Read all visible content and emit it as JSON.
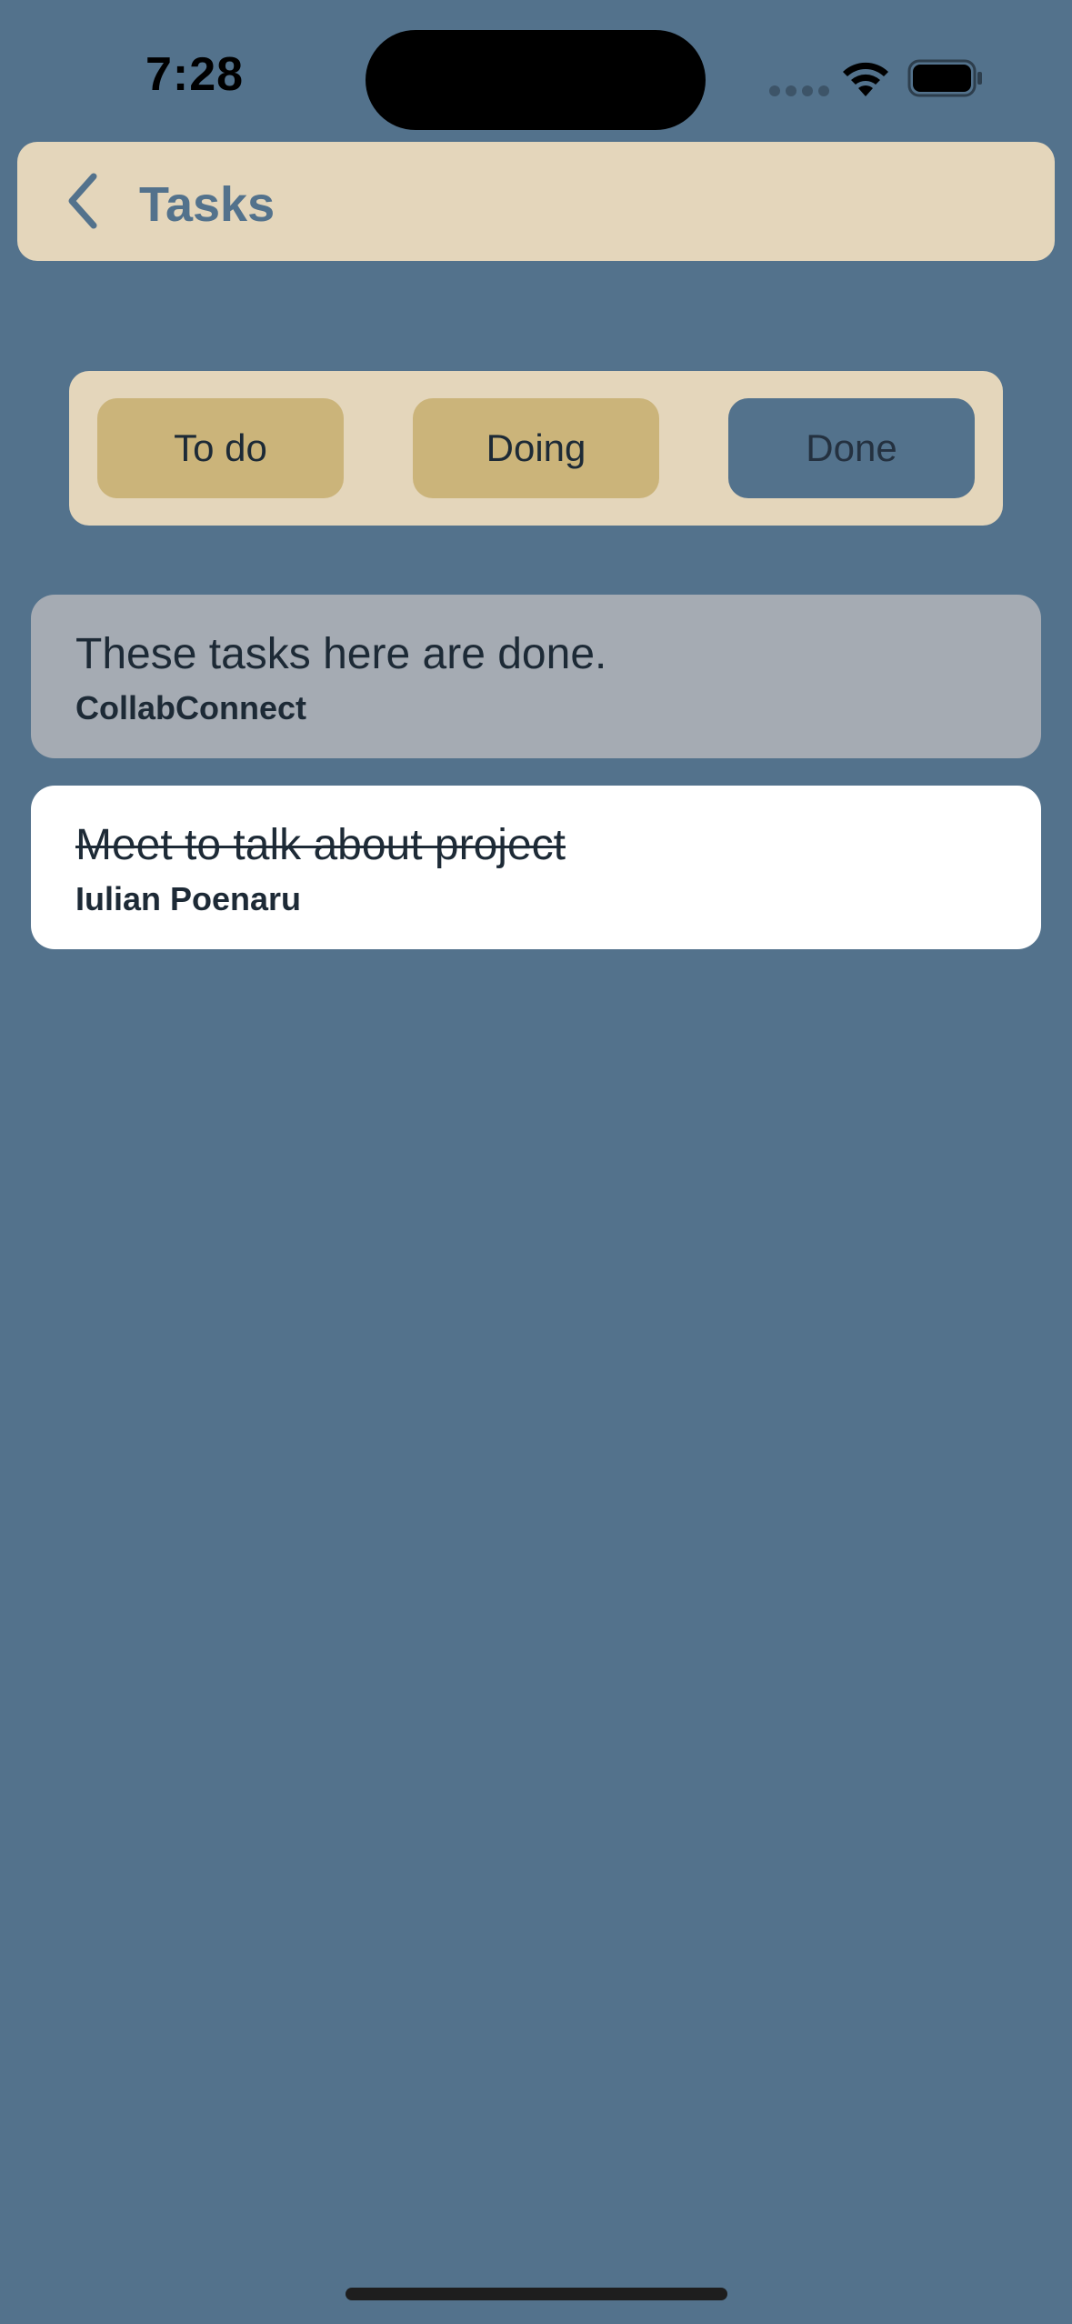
{
  "status_bar": {
    "time": "7:28",
    "icons": [
      "signal-dots-icon",
      "wifi-icon",
      "battery-icon"
    ]
  },
  "nav": {
    "back_icon": "chevron-left-icon",
    "title": "Tasks"
  },
  "tabs": [
    {
      "label": "To do",
      "selected": false
    },
    {
      "label": "Doing",
      "selected": false
    },
    {
      "label": "Done",
      "selected": true
    }
  ],
  "info_card": {
    "title": "These tasks here are done.",
    "subtitle": "CollabConnect"
  },
  "tasks": [
    {
      "title": "Meet to talk about project",
      "assignee": "Iulian Poenaru",
      "done": true
    }
  ],
  "colors": {
    "background": "#53728c",
    "panel": "#e4d6bb",
    "tab_inactive": "#cbb47a",
    "tab_active": "#53728c",
    "info_card": "#a5abb3",
    "task_card": "#ffffff",
    "text_dark": "#1d2a36"
  }
}
